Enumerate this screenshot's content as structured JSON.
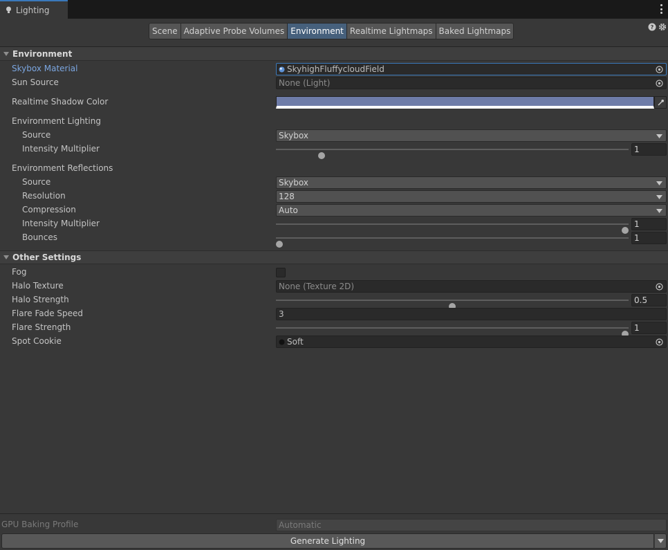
{
  "window": {
    "tab_title": "Lighting"
  },
  "toolbar": {
    "tabs": [
      {
        "label": "Scene"
      },
      {
        "label": "Adaptive Probe Volumes"
      },
      {
        "label": "Environment"
      },
      {
        "label": "Realtime Lightmaps"
      },
      {
        "label": "Baked Lightmaps"
      }
    ],
    "active_tab": "Environment"
  },
  "environment": {
    "header": "Environment",
    "skybox_material": {
      "label": "Skybox Material",
      "value": "SkyhighFluffycloudField"
    },
    "sun_source": {
      "label": "Sun Source",
      "value": "None (Light)"
    },
    "realtime_shadow_color": {
      "label": "Realtime Shadow Color",
      "color": "#6e7ca8"
    },
    "lighting": {
      "label": "Environment Lighting",
      "source": {
        "label": "Source",
        "value": "Skybox"
      },
      "intensity": {
        "label": "Intensity Multiplier",
        "value": "1",
        "fraction": 0.13
      }
    },
    "reflections": {
      "label": "Environment Reflections",
      "source": {
        "label": "Source",
        "value": "Skybox"
      },
      "resolution": {
        "label": "Resolution",
        "value": "128"
      },
      "compression": {
        "label": "Compression",
        "value": "Auto"
      },
      "intensity": {
        "label": "Intensity Multiplier",
        "value": "1",
        "fraction": 0.99
      },
      "bounces": {
        "label": "Bounces",
        "value": "1",
        "fraction": 0.01
      }
    }
  },
  "other_settings": {
    "header": "Other Settings",
    "fog": {
      "label": "Fog",
      "checked": false
    },
    "halo_texture": {
      "label": "Halo Texture",
      "value": "None (Texture 2D)"
    },
    "halo_strength": {
      "label": "Halo Strength",
      "value": "0.5",
      "fraction": 0.5
    },
    "flare_fade_speed": {
      "label": "Flare Fade Speed",
      "value": "3"
    },
    "flare_strength": {
      "label": "Flare Strength",
      "value": "1",
      "fraction": 0.99
    },
    "spot_cookie": {
      "label": "Spot Cookie",
      "value": "Soft"
    }
  },
  "footer": {
    "gpu_baking_profile": {
      "label": "GPU Baking Profile",
      "value": "Automatic"
    },
    "generate_label": "Generate Lighting"
  },
  "colors": {
    "accent": "#3a79bb",
    "active_tab": "#46607c",
    "label_highlight": "#7ba6e0"
  }
}
